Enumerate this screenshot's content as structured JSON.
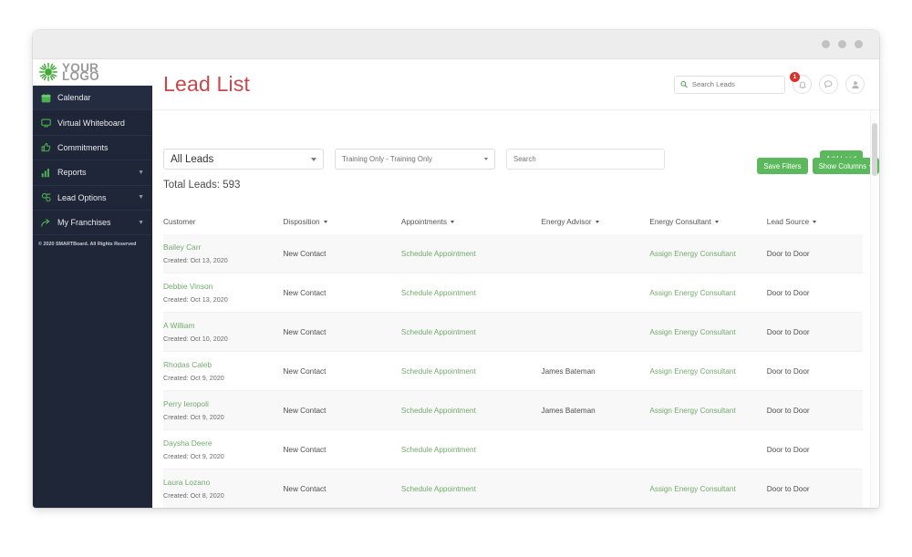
{
  "window": {
    "titlebar_dots": 3
  },
  "brand": {
    "logo_icon": "sunburst-icon",
    "logo_line1": "YOUR",
    "logo_line2": "LOGO",
    "accent_green": "#5cb85c",
    "sidebar_bg": "#1e2637",
    "title_red": "#c8474b"
  },
  "sidebar": {
    "items": [
      {
        "label": "Calendar",
        "icon": "calendar-icon",
        "has_chevron": false,
        "active": true
      },
      {
        "label": "Virtual Whiteboard",
        "icon": "monitor-icon",
        "has_chevron": false,
        "active": false
      },
      {
        "label": "Commitments",
        "icon": "thumbs-up-icon",
        "has_chevron": false,
        "active": false
      },
      {
        "label": "Reports",
        "icon": "bar-chart-icon",
        "has_chevron": true,
        "active": false
      },
      {
        "label": "Lead Options",
        "icon": "gear-icon",
        "has_chevron": true,
        "active": false
      },
      {
        "label": "My Franchises",
        "icon": "arrow-share-icon",
        "has_chevron": true,
        "active": false
      }
    ],
    "copyright": "© 2020 SMARTBoard. All Rights Reserved"
  },
  "header": {
    "page_title": "Lead List",
    "search": {
      "placeholder": "Search Leads",
      "value": "",
      "icon": "search-icon"
    },
    "icons": [
      {
        "name": "bell-icon",
        "badge": "1"
      },
      {
        "name": "chat-icon",
        "badge": ""
      },
      {
        "name": "user-icon",
        "badge": ""
      }
    ]
  },
  "filters": {
    "lead_scope": {
      "value": "All Leads",
      "options": [
        "All Leads"
      ]
    },
    "training": {
      "value": "Training Only - Training Only",
      "options": [
        "Training Only - Training Only"
      ]
    },
    "search": {
      "placeholder": "Search",
      "value": ""
    },
    "add_lead_label": "Add Lead",
    "save_filters_label": "Save Filters",
    "show_columns_label": "Show Columns"
  },
  "summary": {
    "total_leads": "Total Leads: 593"
  },
  "table": {
    "columns": [
      {
        "label": "Customer",
        "sortable": false
      },
      {
        "label": "Disposition",
        "sortable": true
      },
      {
        "label": "Appointments",
        "sortable": true
      },
      {
        "label": "Energy Advisor",
        "sortable": true
      },
      {
        "label": "Energy Consultant",
        "sortable": true
      },
      {
        "label": "Lead Source",
        "sortable": true
      }
    ],
    "rows": [
      {
        "customer": "Bailey Carr",
        "created": "Created: Oct 13, 2020",
        "disposition": "New Contact",
        "appointment": "Schedule Appointment",
        "energy_advisor": "",
        "energy_consultant": "Assign Energy Consultant",
        "lead_source": "Door to Door"
      },
      {
        "customer": "Debbie Vinson",
        "created": "Created: Oct 13, 2020",
        "disposition": "New Contact",
        "appointment": "Schedule Appointment",
        "energy_advisor": "",
        "energy_consultant": "Assign Energy Consultant",
        "lead_source": "Door to Door"
      },
      {
        "customer": "A William",
        "created": "Created: Oct 10, 2020",
        "disposition": "New Contact",
        "appointment": "Schedule Appointment",
        "energy_advisor": "",
        "energy_consultant": "Assign Energy Consultant",
        "lead_source": "Door to Door"
      },
      {
        "customer": "Rhodas Caleb",
        "created": "Created: Oct 9, 2020",
        "disposition": "New Contact",
        "appointment": "Schedule Appointment",
        "energy_advisor": "James Bateman",
        "energy_consultant": "Assign Energy Consultant",
        "lead_source": "Door to Door"
      },
      {
        "customer": "Perry Ieropoli",
        "created": "Created: Oct 9, 2020",
        "disposition": "New Contact",
        "appointment": "Schedule Appointment",
        "energy_advisor": "James Bateman",
        "energy_consultant": "Assign Energy Consultant",
        "lead_source": "Door to Door"
      },
      {
        "customer": "Daysha Deere",
        "created": "Created: Oct 9, 2020",
        "disposition": "New Contact",
        "appointment": "Schedule Appointment",
        "energy_advisor": "",
        "energy_consultant": "",
        "lead_source": "Door to Door"
      },
      {
        "customer": "Laura Lozano",
        "created": "Created: Oct 8, 2020",
        "disposition": "New Contact",
        "appointment": "Schedule Appointment",
        "energy_advisor": "",
        "energy_consultant": "Assign Energy Consultant",
        "lead_source": "Door to Door"
      }
    ]
  }
}
